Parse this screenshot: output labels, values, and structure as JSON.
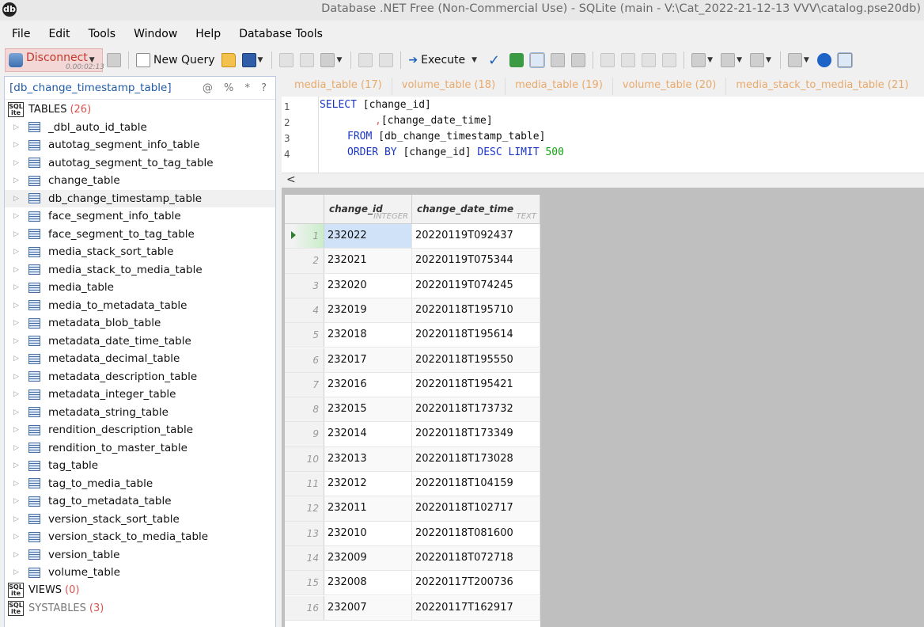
{
  "window": {
    "app_icon_glyph": "db",
    "title": "Database .NET Free (Non-Commercial Use)  -  SQLite (main - V:\\Cat_2022-21-12-13 VVV\\catalog.pse20db)"
  },
  "menu": [
    "File",
    "Edit",
    "Tools",
    "Window",
    "Help",
    "Database Tools"
  ],
  "toolbar": {
    "disconnect_label": "Disconnect",
    "connection_time": "0.00:02:13",
    "new_query_label": "New Query",
    "execute_label": "Execute"
  },
  "left_panel": {
    "header": "[db_change_timestamp_table]",
    "header_tools": "@ % * ?",
    "tables_label": "TABLES",
    "tables_count": "(26)",
    "tables": [
      "_dbl_auto_id_table",
      "autotag_segment_info_table",
      "autotag_segment_to_tag_table",
      "change_table",
      "db_change_timestamp_table",
      "face_segment_info_table",
      "face_segment_to_tag_table",
      "media_stack_sort_table",
      "media_stack_to_media_table",
      "media_table",
      "media_to_metadata_table",
      "metadata_blob_table",
      "metadata_date_time_table",
      "metadata_decimal_table",
      "metadata_description_table",
      "metadata_integer_table",
      "metadata_string_table",
      "rendition_description_table",
      "rendition_to_master_table",
      "tag_table",
      "tag_to_media_table",
      "tag_to_metadata_table",
      "version_stack_sort_table",
      "version_stack_to_media_table",
      "version_table",
      "volume_table"
    ],
    "selected_table": "db_change_timestamp_table",
    "views_label": "VIEWS",
    "views_count": "(0)",
    "systables_label": "SYSTABLES",
    "systables_count": "(3)"
  },
  "doc_tabs": [
    "media_table (17)",
    "volume_table (18)",
    "media_table (19)",
    "volume_table (20)",
    "media_stack_to_media_table (21)"
  ],
  "editor": {
    "line_numbers": [
      "1",
      "2",
      "3",
      "4"
    ],
    "l1_kw": "SELECT",
    "l1_rest": " [change_id]",
    "l2_comma": ",",
    "l2_rest": "[change_date_time]",
    "l3_kw": "FROM",
    "l3_rest": " [db_change_timestamp_table]",
    "l4_kw1": "ORDER BY",
    "l4_mid": " [change_id] ",
    "l4_kw2": "DESC LIMIT",
    "l4_num": "500"
  },
  "grid": {
    "columns": [
      {
        "name": "change_id",
        "type": "INTEGER"
      },
      {
        "name": "change_date_time",
        "type": "TEXT"
      }
    ],
    "rows": [
      {
        "n": "1",
        "id": "232022",
        "dt": "20220119T092437"
      },
      {
        "n": "2",
        "id": "232021",
        "dt": "20220119T075344"
      },
      {
        "n": "3",
        "id": "232020",
        "dt": "20220119T074245"
      },
      {
        "n": "4",
        "id": "232019",
        "dt": "20220118T195710"
      },
      {
        "n": "5",
        "id": "232018",
        "dt": "20220118T195614"
      },
      {
        "n": "6",
        "id": "232017",
        "dt": "20220118T195550"
      },
      {
        "n": "7",
        "id": "232016",
        "dt": "20220118T195421"
      },
      {
        "n": "8",
        "id": "232015",
        "dt": "20220118T173732"
      },
      {
        "n": "9",
        "id": "232014",
        "dt": "20220118T173349"
      },
      {
        "n": "10",
        "id": "232013",
        "dt": "20220118T173028"
      },
      {
        "n": "11",
        "id": "232012",
        "dt": "20220118T104159"
      },
      {
        "n": "12",
        "id": "232011",
        "dt": "20220118T102717"
      },
      {
        "n": "13",
        "id": "232010",
        "dt": "20220118T081600"
      },
      {
        "n": "14",
        "id": "232009",
        "dt": "20220118T072718"
      },
      {
        "n": "15",
        "id": "232008",
        "dt": "20220117T200736"
      },
      {
        "n": "16",
        "id": "232007",
        "dt": "20220117T162917"
      }
    ]
  }
}
